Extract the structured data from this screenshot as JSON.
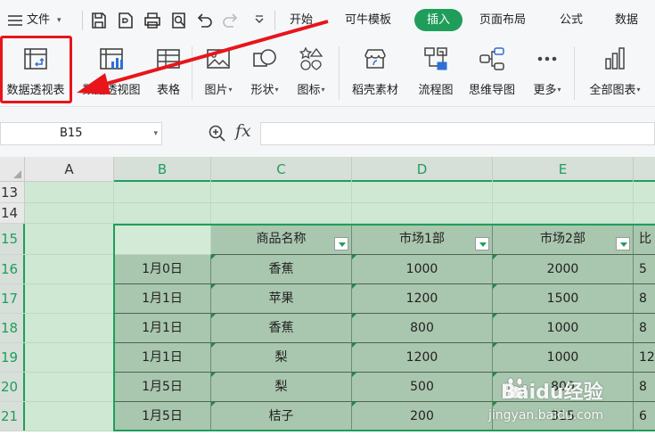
{
  "menubar": {
    "file_label": "文件",
    "tabs": [
      {
        "label": "开始",
        "active": false
      },
      {
        "label": "可牛模板",
        "active": false
      },
      {
        "label": "插入",
        "active": true
      },
      {
        "label": "页面布局",
        "active": false
      },
      {
        "label": "公式",
        "active": false
      },
      {
        "label": "数据",
        "active": false
      }
    ],
    "quick_icons": [
      "save-icon",
      "pdf-export-icon",
      "print-icon",
      "print-preview-icon",
      "undo-icon",
      "redo-icon",
      "dropdown-more-icon"
    ]
  },
  "ribbon": {
    "buttons": [
      {
        "label": "数据透视表",
        "icon": "pivot-table-icon"
      },
      {
        "label": "数据透视图",
        "icon": "pivot-chart-icon"
      },
      {
        "label": "表格",
        "icon": "table-icon"
      },
      {
        "label": "图片",
        "icon": "picture-icon",
        "dropdown": true
      },
      {
        "label": "形状",
        "icon": "shape-icon",
        "dropdown": true
      },
      {
        "label": "图标",
        "icon": "icon-library-icon",
        "dropdown": true
      },
      {
        "label": "稻壳素材",
        "icon": "material-store-icon"
      },
      {
        "label": "流程图",
        "icon": "flowchart-icon"
      },
      {
        "label": "思维导图",
        "icon": "mindmap-icon"
      },
      {
        "label": "更多",
        "icon": "more-dots-icon",
        "dropdown": true
      },
      {
        "label": "全部图表",
        "icon": "all-charts-icon",
        "dropdown": true
      }
    ]
  },
  "formula": {
    "cell_ref": "B15",
    "fx_label": "fx",
    "content": ""
  },
  "sheet": {
    "columns": [
      "A",
      "B",
      "C",
      "D",
      "E"
    ],
    "rows": [
      "13",
      "14",
      "15",
      "16",
      "17",
      "18",
      "19",
      "20",
      "21"
    ],
    "header": [
      "",
      "商品名称",
      "市场1部",
      "市场2部",
      "比"
    ],
    "data": [
      [
        "1月0日",
        "香蕉",
        "1000",
        "2000",
        "5"
      ],
      [
        "1月1日",
        "苹果",
        "1200",
        "1500",
        "8"
      ],
      [
        "1月1日",
        "香蕉",
        "800",
        "1000",
        "8"
      ],
      [
        "1月1日",
        "梨",
        "1200",
        "1000",
        "12"
      ],
      [
        "1月5日",
        "梨",
        "500",
        "800",
        "8"
      ],
      [
        "1月5日",
        "桔子",
        "200",
        "315",
        "6"
      ]
    ]
  },
  "watermark": {
    "brand": "Baidu经验",
    "url": "jingyan.baidu.com"
  },
  "colors": {
    "accent": "#1f9e5b",
    "highlight": "#e8151b",
    "table_fill": "#a9c6ae",
    "selection_fill": "#cfe8d3"
  }
}
